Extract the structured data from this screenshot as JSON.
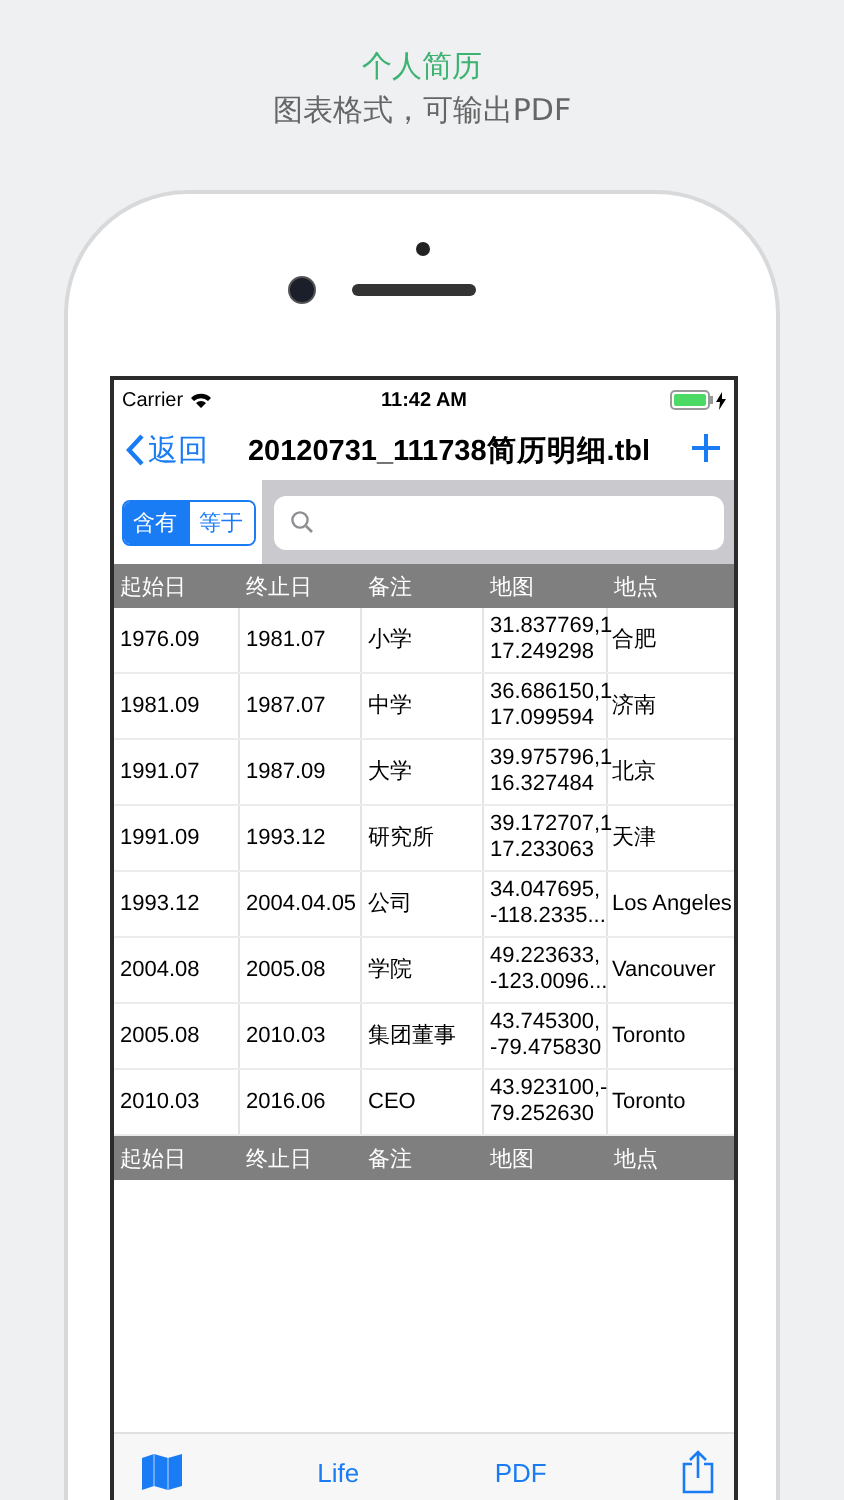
{
  "caption": {
    "title": "个人简历",
    "subtitle": "图表格式，可输出PDF"
  },
  "status_bar": {
    "carrier": "Carrier",
    "time": "11:42 AM",
    "charging": true
  },
  "nav_bar": {
    "back": "返回",
    "title": "20120731_111738简历明细.tbl"
  },
  "filter": {
    "modes": [
      {
        "label": "含有",
        "selected": true
      },
      {
        "label": "等于",
        "selected": false
      }
    ]
  },
  "table": {
    "columns": [
      "起始日",
      "终止日",
      "备注",
      "地图",
      "地点"
    ],
    "rows": [
      [
        "1976.09",
        "1981.07",
        "小学",
        "31.837769,1\n17.249298",
        "合肥"
      ],
      [
        "1981.09",
        "1987.07",
        "中学",
        "36.686150,1\n17.099594",
        "济南"
      ],
      [
        "1991.07",
        "1987.09",
        "大学",
        "39.975796,1\n16.327484",
        "北京"
      ],
      [
        "1991.09",
        "1993.12",
        "研究所",
        "39.172707,1\n17.233063",
        "天津"
      ],
      [
        "1993.12",
        "2004.04.05",
        "公司",
        "34.047695,\n-118.2335...",
        "Los Angeles"
      ],
      [
        "2004.08",
        "2005.08",
        "学院",
        "49.223633,\n-123.0096...",
        "Vancouver"
      ],
      [
        "2005.08",
        "2010.03",
        "集团董事",
        "43.745300,\n-79.475830",
        "Toronto"
      ],
      [
        "2010.03",
        "2016.06",
        "CEO",
        "43.923100,-\n79.252630",
        "Toronto"
      ]
    ],
    "footer_columns": [
      "起始日",
      "终止日",
      "备注",
      "地图",
      "地点"
    ]
  },
  "toolbar": {
    "buttons": [
      "Life",
      "PDF"
    ]
  }
}
